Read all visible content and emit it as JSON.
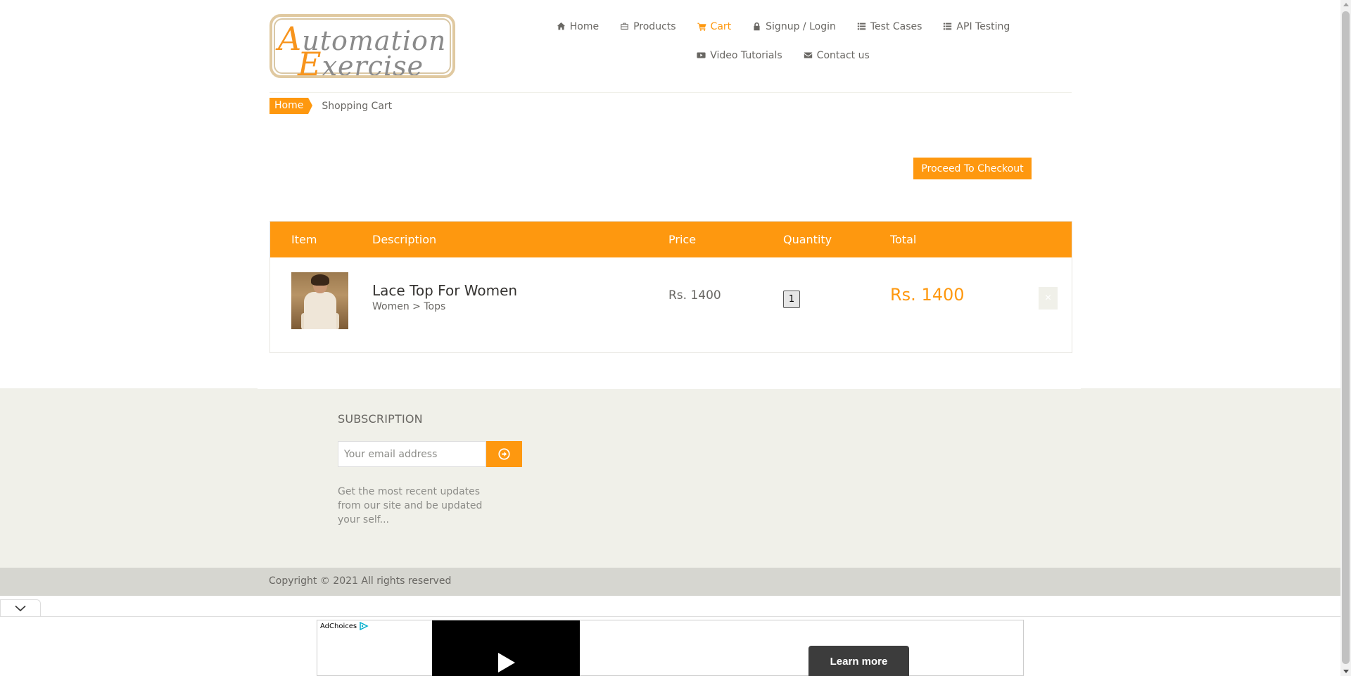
{
  "header": {
    "logo": {
      "line1_cap": "A",
      "line1_rest": "utomation",
      "line2_cap": "E",
      "line2_rest": "xercise"
    },
    "nav": [
      {
        "label": "Home",
        "icon": "home-icon"
      },
      {
        "label": "Products",
        "icon": "briefcase-icon"
      },
      {
        "label": "Cart",
        "icon": "cart-icon",
        "active": true
      },
      {
        "label": "Signup / Login",
        "icon": "lock-icon"
      },
      {
        "label": "Test Cases",
        "icon": "list-icon"
      },
      {
        "label": "API Testing",
        "icon": "list-icon"
      },
      {
        "label": "Video Tutorials",
        "icon": "youtube-icon"
      },
      {
        "label": "Contact us",
        "icon": "envelope-icon"
      }
    ]
  },
  "breadcrumb": {
    "home": "Home",
    "current": "Shopping Cart"
  },
  "checkout": {
    "label": "Proceed To Checkout"
  },
  "cart": {
    "headers": {
      "item": "Item",
      "description": "Description",
      "price": "Price",
      "quantity": "Quantity",
      "total": "Total"
    },
    "rows": [
      {
        "name": "Lace Top For Women",
        "category": "Women > Tops",
        "price": "Rs. 1400",
        "quantity": "1",
        "total": "Rs. 1400",
        "delete_icon": "×"
      }
    ]
  },
  "subscription": {
    "title": "SUBSCRIPTION",
    "placeholder": "Your email address",
    "text": "Get the most recent updates from our site and be updated your self..."
  },
  "footer": {
    "copyright": "Copyright © 2021 All rights reserved"
  },
  "ad": {
    "adchoices": "AdChoices",
    "learn_more": "Learn more"
  },
  "colors": {
    "accent": "#fe980f",
    "footer_bg": "#f0f0e9",
    "footer_bottom_bg": "#d6d6d0"
  }
}
